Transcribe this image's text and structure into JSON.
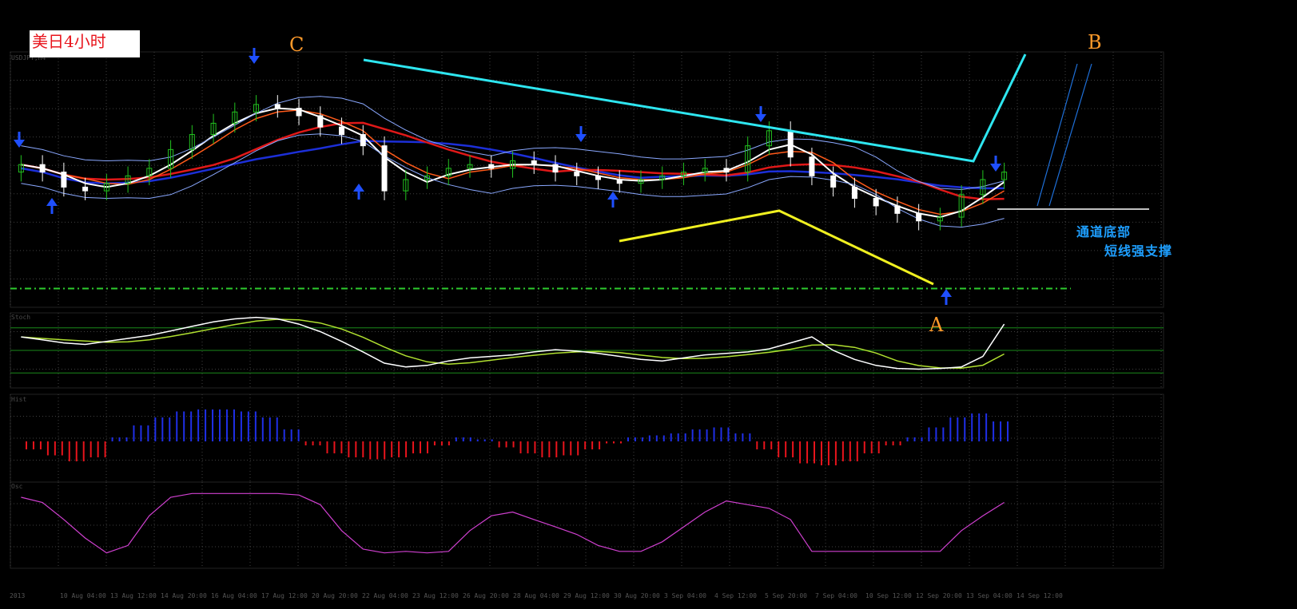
{
  "title": "美日4小时",
  "wave_labels": {
    "a": "A",
    "b": "B",
    "c": "C"
  },
  "annotations": {
    "channel_bottom": "通道底部",
    "short_support": "短线强支撑"
  },
  "colors": {
    "bull_candle": "#22c21f",
    "bear_candle": "#ffffff",
    "ma_red": "#e01818",
    "ma_blue": "#1c2fd8",
    "ma_white": "#ffffff",
    "ma_orange": "#ff5a1a",
    "trendline_cyan": "#2ee6f0",
    "trendline_yellow": "#f0f020",
    "support_green": "#2ecc2e",
    "arrow_blue": "#1f4fff",
    "hist_up": "#1f2fe8",
    "hist_down": "#e8141c",
    "osc_line": "#d040d0",
    "stoch_main": "#ffffff",
    "stoch_signal": "#b0e030",
    "grid": "#404040"
  },
  "chart_data": {
    "type": "candlestick",
    "symbol": "USDJPY",
    "timeframe": "H4",
    "x_labels": [
      "2013",
      "10 Aug 04:00",
      "13 Aug 12:00",
      "14 Aug 20:00",
      "16 Aug 04:00",
      "17 Aug 12:00",
      "20 Aug 20:00",
      "22 Aug 04:00",
      "23 Aug 12:00",
      "26 Aug 20:00",
      "28 Aug 04:00",
      "29 Aug 12:00",
      "30 Aug 20:00",
      "3 Sep 04:00",
      "4 Sep 12:00",
      "5 Sep 20:00",
      "7 Sep 04:00",
      "10 Sep 12:00",
      "12 Sep 20:00",
      "13 Sep 04:00",
      "14 Sep 12:00"
    ],
    "close_series": [
      97.6,
      97.4,
      97.0,
      96.9,
      97.1,
      97.3,
      97.5,
      98.0,
      98.4,
      98.7,
      99.0,
      99.2,
      99.1,
      98.9,
      98.6,
      98.4,
      98.1,
      96.9,
      97.2,
      97.3,
      97.5,
      97.6,
      97.5,
      97.7,
      97.6,
      97.4,
      97.3,
      97.2,
      97.1,
      97.2,
      97.3,
      97.4,
      97.5,
      97.4,
      98.1,
      98.5,
      97.8,
      97.3,
      97.0,
      96.7,
      96.5,
      96.3,
      96.1,
      96.2,
      96.8,
      97.2,
      97.4
    ],
    "stochastic": [
      68,
      64,
      60,
      58,
      62,
      66,
      70,
      76,
      82,
      88,
      92,
      94,
      92,
      85,
      75,
      62,
      48,
      33,
      28,
      30,
      36,
      40,
      42,
      44,
      48,
      51,
      49,
      46,
      42,
      38,
      36,
      40,
      44,
      46,
      48,
      52,
      60,
      68,
      50,
      38,
      30,
      26,
      25,
      26,
      28,
      42,
      85
    ],
    "histogram": [
      -0.2,
      -0.35,
      -0.5,
      -0.4,
      0.1,
      0.4,
      0.6,
      0.75,
      0.8,
      0.8,
      0.75,
      0.6,
      0.3,
      -0.1,
      -0.3,
      -0.4,
      -0.45,
      -0.4,
      -0.3,
      -0.1,
      0.1,
      0.05,
      -0.15,
      -0.3,
      -0.4,
      -0.35,
      -0.2,
      -0.05,
      0.1,
      0.15,
      0.2,
      0.3,
      0.35,
      0.2,
      -0.2,
      -0.4,
      -0.55,
      -0.6,
      -0.5,
      -0.3,
      -0.1,
      0.1,
      0.35,
      0.6,
      0.7,
      0.5
    ],
    "oscillator": [
      85,
      78,
      55,
      30,
      10,
      20,
      60,
      85,
      90,
      90,
      90,
      90,
      90,
      88,
      75,
      40,
      15,
      10,
      12,
      10,
      12,
      40,
      60,
      65,
      55,
      45,
      35,
      20,
      12,
      12,
      25,
      45,
      65,
      80,
      75,
      70,
      55,
      12,
      12,
      12,
      12,
      12,
      12,
      12,
      40,
      60,
      78
    ],
    "support_level": 94.3
  },
  "pane_labels": {
    "main": "USDJPY,H4",
    "stoch": "Stoch",
    "hist": "Hist",
    "osc": "Osc"
  }
}
